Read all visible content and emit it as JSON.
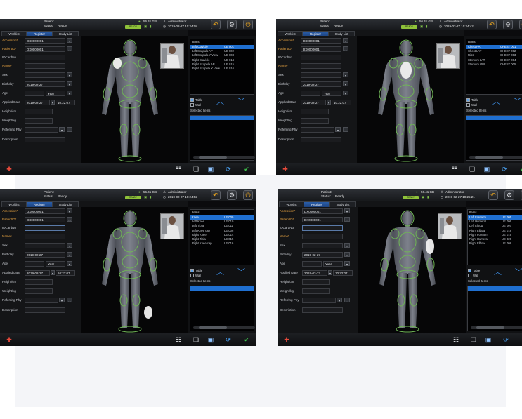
{
  "panels": [
    {
      "patient_label": "Patient:",
      "status_label": "Status:",
      "status_value": "Ready",
      "storage": "56.41 GB",
      "user": "Administrator",
      "datetime": "2019-02-27  10:24:08",
      "tabs": [
        "Worklist",
        "Register",
        "Study List"
      ],
      "active_tab": 1,
      "fields": {
        "accession_label": "Accession*",
        "accession_value": "DX0000001",
        "patient_id_label": "PatientID*",
        "patient_id_value": "DX0000001",
        "id_card_label": "IDCardNo",
        "name_label": "Name*",
        "sex_label": "Sex",
        "birthday_label": "Birthday",
        "birthday_value": "2019-02-27",
        "age_label": "Age",
        "age_unit": "Year",
        "applied_date_label": "Applied Date",
        "applied_date_value": "2019-02-27",
        "applied_time_value": "10:22:07",
        "height_label": "Height/cm",
        "weight_label": "Weight/kg",
        "referring_label": "Referring Phy",
        "description_label": "Description"
      },
      "items_header": "Items",
      "items": [
        {
          "name": "Left Clavicle",
          "code": "UE 001"
        },
        {
          "name": "Left Scapula AP",
          "code": "UE 002"
        },
        {
          "name": "Left Scapula Y View",
          "code": "UE 003"
        },
        {
          "name": "Right Clavicle",
          "code": "UE 014"
        },
        {
          "name": "Right Scapula AP",
          "code": "UE 015"
        },
        {
          "name": "Right Scapula Y View",
          "code": "UE 016"
        }
      ],
      "selected_item_index": 0,
      "table_label": "Table",
      "wall_label": "Wall",
      "selected_items_label": "Selected Items",
      "highlight": "left-shoulder"
    },
    {
      "patient_label": "Patient:",
      "status_label": "Status:",
      "status_value": "Ready",
      "storage": "56.41 GB",
      "user": "Administrator",
      "datetime": "2019-02-27  10:24:42",
      "tabs": [
        "Worklist",
        "Register",
        "Study List"
      ],
      "active_tab": 1,
      "fields": {
        "accession_label": "Accession*",
        "accession_value": "DX0000001",
        "patient_id_label": "PatientID*",
        "patient_id_value": "DX0000001",
        "id_card_label": "IDCardNo",
        "name_label": "Name*",
        "sex_label": "Sex",
        "birthday_label": "Birthday",
        "birthday_value": "2019-02-27",
        "age_label": "Age",
        "age_unit": "Year",
        "applied_date_label": "Applied Date",
        "applied_date_value": "2019-02-27",
        "applied_time_value": "10:22:07",
        "height_label": "Height/cm",
        "weight_label": "Weight/kg",
        "referring_label": "Referring Phy",
        "description_label": "Description"
      },
      "items_header": "Items",
      "items": [
        {
          "name": "Chest PA",
          "code": "CHEST 001"
        },
        {
          "name": "Chest LAT",
          "code": "CHEST 002"
        },
        {
          "name": "Ribs",
          "code": "CHEST 003"
        },
        {
          "name": "Sternum LAT",
          "code": "CHEST 004"
        },
        {
          "name": "Sternum OBL",
          "code": "CHEST 005"
        }
      ],
      "selected_item_index": 0,
      "table_label": "Table",
      "wall_label": "Wall",
      "selected_items_label": "Selected Items",
      "highlight": "chest"
    },
    {
      "patient_label": "Patient:",
      "status_label": "Status:",
      "status_value": "Ready",
      "storage": "56.41 GB",
      "user": "Administrator",
      "datetime": "2019-02-27  10:24:52",
      "tabs": [
        "Worklist",
        "Register",
        "Study List"
      ],
      "active_tab": 1,
      "fields": {
        "accession_label": "Accession*",
        "accession_value": "DX0000001",
        "patient_id_label": "PatientID*",
        "patient_id_value": "DX0000001",
        "id_card_label": "IDCardNo",
        "name_label": "Name*",
        "sex_label": "Sex",
        "birthday_label": "Birthday",
        "birthday_value": "2019-02-27",
        "age_label": "Age",
        "age_unit": "Year",
        "applied_date_label": "Applied Date",
        "applied_date_value": "2019-02-27",
        "applied_time_value": "10:22:07",
        "height_label": "Height/cm",
        "weight_label": "Weight/kg",
        "referring_label": "Referring Phy",
        "description_label": "Description"
      },
      "items_header": "Items",
      "items": [
        {
          "name": "Knee",
          "code": "LE 009"
        },
        {
          "name": "Left Knee",
          "code": "LE 010"
        },
        {
          "name": "Left Tibia",
          "code": "LE 011"
        },
        {
          "name": "Left Knee cap",
          "code": "LE 006"
        },
        {
          "name": "Right Knee",
          "code": "LE 014"
        },
        {
          "name": "Right Tibia",
          "code": "LE 015"
        },
        {
          "name": "Right Knee cap",
          "code": "LE 016"
        }
      ],
      "selected_item_index": 0,
      "table_label": "Table",
      "wall_label": "Wall",
      "selected_items_label": "Selected Items",
      "highlight": "left-knee"
    },
    {
      "patient_label": "Patient:",
      "status_label": "Status:",
      "status_value": "Ready",
      "storage": "56.41 GB",
      "user": "Administrator",
      "datetime": "2019-02-27  10:25:21",
      "tabs": [
        "Worklist",
        "Register",
        "Study List"
      ],
      "active_tab": 1,
      "fields": {
        "accession_label": "Accession*",
        "accession_value": "DX0000001",
        "patient_id_label": "PatientID*",
        "patient_id_value": "DX0000001",
        "id_card_label": "IDCardNo",
        "name_label": "Name*",
        "sex_label": "Sex",
        "birthday_label": "Birthday",
        "birthday_value": "2019-02-27",
        "age_label": "Age",
        "age_unit": "Year",
        "applied_date_label": "Applied Date",
        "applied_date_value": "2019-02-27",
        "applied_time_value": "10:22:07",
        "height_label": "Height/cm",
        "weight_label": "Weight/kg",
        "referring_label": "Referring Phy",
        "description_label": "Description"
      },
      "items_header": "Items",
      "items": [
        {
          "name": "Left Forearm",
          "code": "UE 005"
        },
        {
          "name": "Left Humeral",
          "code": "UE 006"
        },
        {
          "name": "Left Elbow",
          "code": "UE 007"
        },
        {
          "name": "Right Elbow",
          "code": "UE 018"
        },
        {
          "name": "Right Forearm",
          "code": "UE 019"
        },
        {
          "name": "Right Humeral",
          "code": "UE 020"
        },
        {
          "name": "Right Elbow",
          "code": "UE 008"
        }
      ],
      "selected_item_index": 0,
      "table_label": "Table",
      "wall_label": "Wall",
      "selected_items_label": "Selected Items",
      "highlight": "right-arm"
    }
  ],
  "icons": {
    "topbar": [
      "back-arrow-icon",
      "gear-icon",
      "power-icon"
    ],
    "bottombar": [
      "emergency-icon",
      "list-check-icon",
      "folder-icon",
      "image-icon",
      "refresh-icon",
      "checkmark-icon"
    ]
  },
  "colors": {
    "selection": "#1f6fd0",
    "highlight": "#f0f0f0",
    "body_outline": "#6fb556",
    "accent_gold": "#e6a21e",
    "required_label": "#e8a442"
  }
}
